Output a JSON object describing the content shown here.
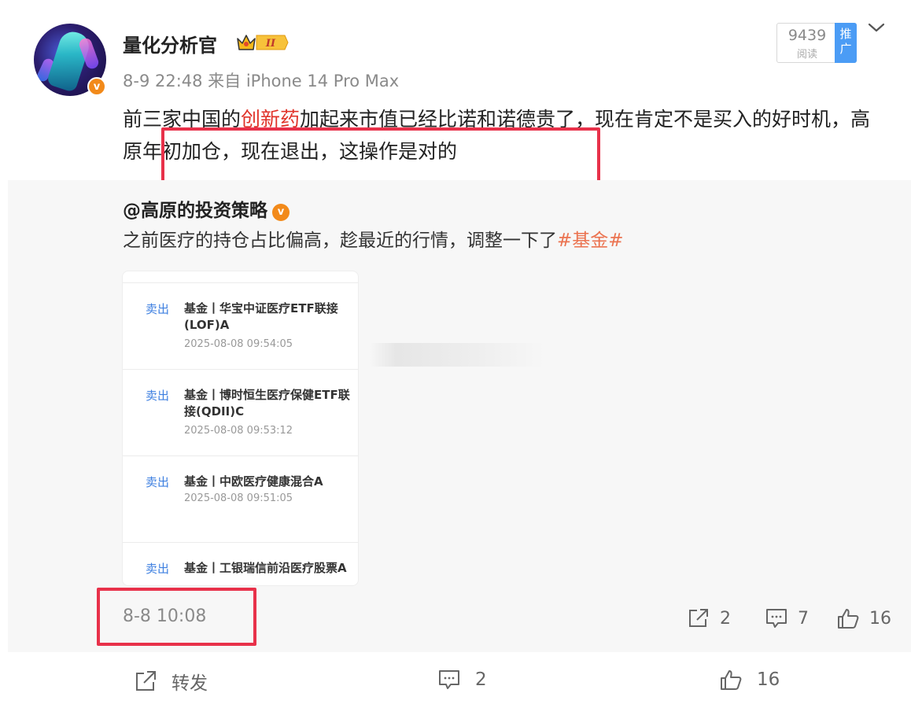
{
  "post": {
    "username": "量化分析官",
    "vip_level": "II",
    "meta": "8-9 22:48  来自 iPhone 14 Pro Max",
    "read_count": "9439",
    "read_label": "阅读",
    "promote_label": "推广",
    "text_before": "前三家中国的",
    "topic": "创新药",
    "text_after": "加起来市值已经比诺和诺德贵了，现在肯定不是买入的好时机，高原年初加仓，现在退出，这操作是对的"
  },
  "repost": {
    "author": "@高原的投资策略",
    "text": "之前医疗的持仓占比偏高，趁最近的行情，调整一下了",
    "hashtag": "#基金#",
    "thumbnail": {
      "items": [
        {
          "action": "卖出",
          "name": "基金丨华宝中证医疗ETF联接(LOF)A",
          "time": "2025-08-08 09:54:05"
        },
        {
          "action": "卖出",
          "name": "基金丨博时恒生医疗保健ETF联接(QDII)C",
          "time": "2025-08-08 09:53:12"
        },
        {
          "action": "卖出",
          "name": "基金丨中欧医疗健康混合A",
          "time": "2025-08-08 09:51:05"
        },
        {
          "action": "卖出",
          "name": "基金丨工银瑞信前沿医疗股票A",
          "time": ""
        }
      ]
    },
    "time": "8-8 10:08",
    "share_count": "2",
    "comment_count": "7",
    "like_count": "16"
  },
  "bottom_bar": {
    "repost_label": "转发",
    "comment_count": "2",
    "like_count": "16"
  },
  "colors": {
    "topic": "#e0332a",
    "hashtag": "#eb7350",
    "highlight_box": "#e8314a",
    "promote_bg": "#4b9cf5",
    "sell": "#3d7fe0"
  }
}
